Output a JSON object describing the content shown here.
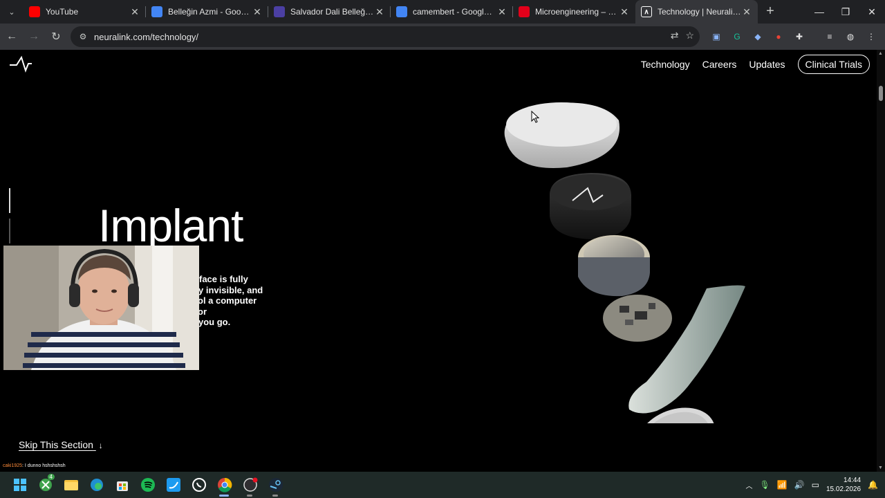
{
  "browser": {
    "tabs": [
      {
        "title": "YouTube",
        "favicon": "youtube-icon",
        "color": "#ff0000",
        "active": false
      },
      {
        "title": "Belleğin Azmi - Google'da Ara",
        "favicon": "google-icon",
        "color": "#4285f4",
        "active": false
      },
      {
        "title": "Salvador Dali Belleğin Azmi",
        "favicon": "site-icon",
        "color": "#4b3fa3",
        "active": false
      },
      {
        "title": "camembert - Google'da Ara",
        "favicon": "google-icon",
        "color": "#4285f4",
        "active": false
      },
      {
        "title": "Microengineering – Master",
        "favicon": "epfl-icon",
        "color": "#e2001a",
        "active": false
      },
      {
        "title": "Technology | Neuralink",
        "favicon": "neuralink-icon",
        "color": "#ffffff",
        "active": true
      }
    ],
    "url": "neuralink.com/technology/"
  },
  "site": {
    "nav": [
      "Technology",
      "Careers",
      "Updates"
    ],
    "cta": "Clinical Trials",
    "hero_title": "Implant",
    "hero_lines": [
      "face is fully",
      "y invisible, and",
      "ol a computer or",
      "you go."
    ],
    "skip": "Skip This Section",
    "skip_arrow": "↓"
  },
  "overlay": {
    "chat_user": "caki1925",
    "chat_message": ": I dunno hshshshsh"
  },
  "taskbar": {
    "icons": [
      "windows-start-icon",
      "xbox-icon",
      "file-explorer-icon",
      "edge-icon",
      "store-icon",
      "spotify-icon",
      "twitter-icon",
      "whatsapp-icon",
      "chrome-icon",
      "obs-icon",
      "steam-icon"
    ],
    "xbox_badge": "4",
    "time": "14:44",
    "date": "15.02.2026"
  }
}
